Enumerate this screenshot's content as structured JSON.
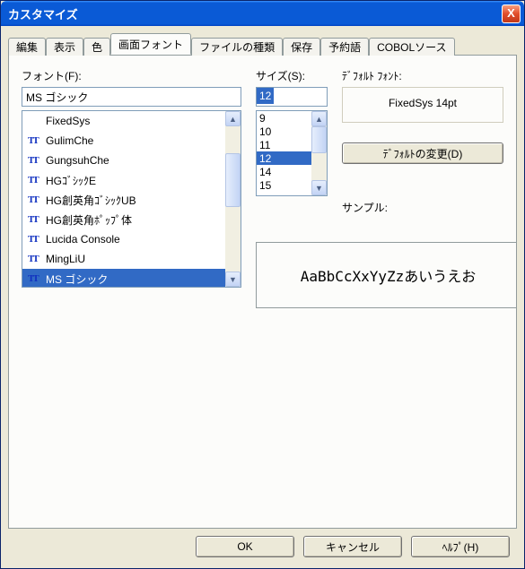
{
  "window": {
    "title": "カスタマイズ"
  },
  "close_label": "X",
  "tabs": [
    {
      "label": "編集"
    },
    {
      "label": "表示"
    },
    {
      "label": "色"
    },
    {
      "label": "画面フォント",
      "active": true
    },
    {
      "label": "ファイルの種類"
    },
    {
      "label": "保存"
    },
    {
      "label": "予約語"
    },
    {
      "label": "COBOLソース"
    }
  ],
  "font_section": {
    "label": "フォント(F):",
    "value": "MS ゴシック",
    "items": [
      {
        "name": "FixedSys",
        "tt": false
      },
      {
        "name": "GulimChe",
        "tt": true
      },
      {
        "name": "GungsuhChe",
        "tt": true
      },
      {
        "name": "HGｺﾞｼｯｸE",
        "tt": true
      },
      {
        "name": "HG創英角ｺﾞｼｯｸUB",
        "tt": true
      },
      {
        "name": "HG創英角ﾎﾟｯﾌﾟ体",
        "tt": true
      },
      {
        "name": "Lucida Console",
        "tt": true
      },
      {
        "name": "MingLiU",
        "tt": true
      },
      {
        "name": "MS ゴシック",
        "tt": true,
        "selected": true
      }
    ]
  },
  "size_section": {
    "label": "サイズ(S):",
    "value": "12",
    "items": [
      {
        "v": "9"
      },
      {
        "v": "10"
      },
      {
        "v": "11"
      },
      {
        "v": "12",
        "selected": true
      },
      {
        "v": "14"
      },
      {
        "v": "15"
      }
    ]
  },
  "default_font": {
    "label": "ﾃﾞﾌｫﾙﾄ ﾌｫﾝﾄ:",
    "value": "FixedSys 14pt",
    "change_button": "ﾃﾞﾌｫﾙﾄの変更(D)"
  },
  "sample": {
    "label": "サンプル:",
    "text": "AaBbCcXxYyZzあいうえお"
  },
  "buttons": {
    "ok": "OK",
    "cancel": "キャンセル",
    "help": "ﾍﾙﾌﾟ(H)"
  },
  "icons": {
    "tt": "TT",
    "up": "▲",
    "down": "▼"
  }
}
